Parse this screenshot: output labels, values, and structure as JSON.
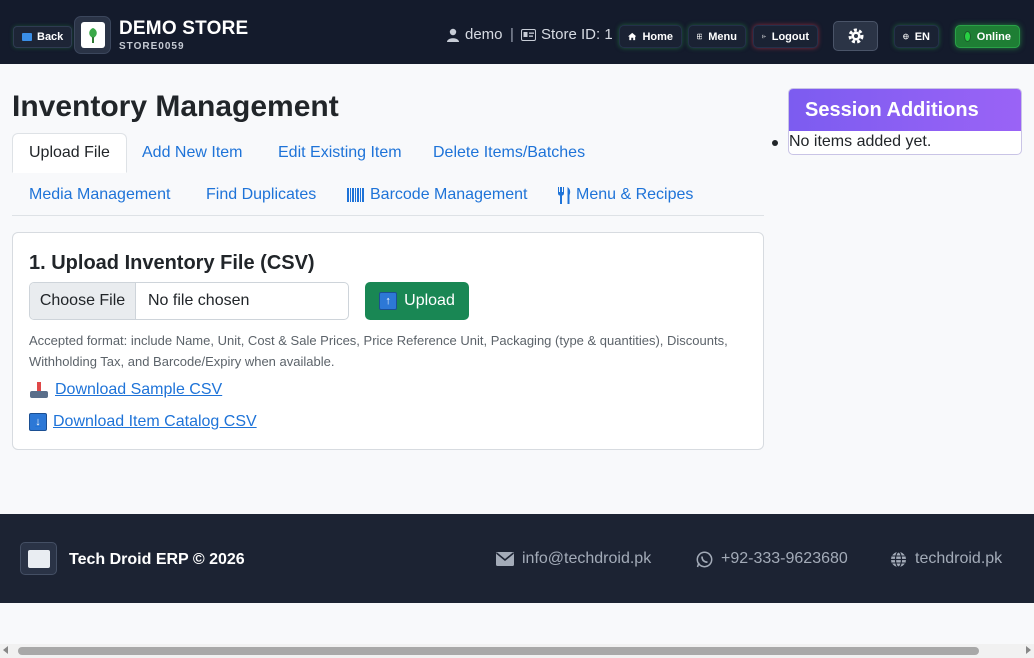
{
  "header": {
    "back_label": "Back",
    "store_name": "DEMO STORE",
    "store_code": "STORE0059",
    "user": "demo",
    "separator": "|",
    "store_id": "Store ID: 1",
    "home_label": "Home",
    "menu_label": "Menu",
    "logout_label": "Logout",
    "lang_label": "EN",
    "status_label": "Online"
  },
  "main": {
    "title": "Inventory Management",
    "tabs": [
      {
        "label": "Upload File",
        "active": true
      },
      {
        "label": "Add New Item"
      },
      {
        "label": "Edit Existing Item"
      },
      {
        "label": "Delete Items/Batches"
      },
      {
        "label": "Media Management"
      },
      {
        "label": "Find Duplicates"
      },
      {
        "label": "Barcode Management"
      },
      {
        "label": "Menu & Recipes"
      }
    ],
    "card": {
      "title": "1. Upload Inventory File (CSV)",
      "choose_label": "Choose File",
      "file_status": "No file chosen",
      "upload_label": "Upload",
      "help_text": "Accepted format: include Name, Unit, Cost & Sale Prices, Price Reference Unit, Packaging (type & quantities), Discounts, Withholding Tax, and Barcode/Expiry when available.",
      "download_sample": "Download Sample CSV",
      "download_catalog": "Download Item Catalog CSV"
    }
  },
  "session": {
    "title": "Session Additions",
    "empty_text": "No items added yet."
  },
  "footer": {
    "brand": "Tech Droid ERP © 2026",
    "email": "info@techdroid.pk",
    "phone": "+92-333-9623680",
    "website": "techdroid.pk"
  },
  "colors": {
    "navbar": "#141b2c",
    "primary_link": "#1e73d8",
    "success": "#198754",
    "session_header": "#8b5cf6",
    "footer": "#1c2333"
  }
}
